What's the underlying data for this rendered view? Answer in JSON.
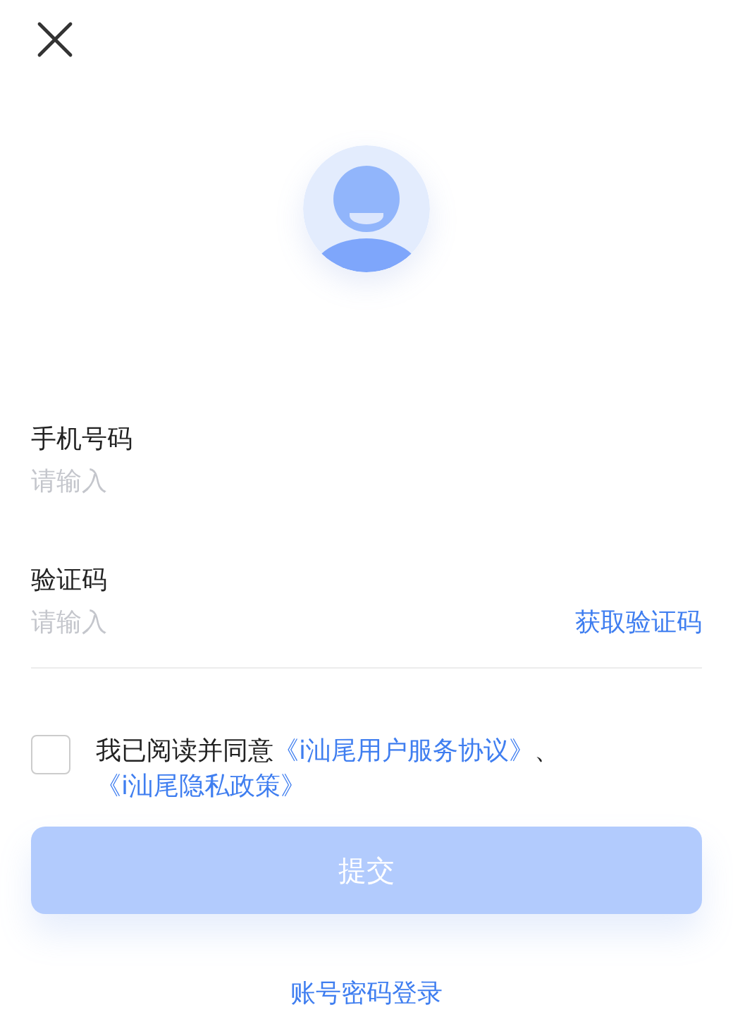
{
  "fields": [
    {
      "label": "手机号码",
      "placeholder": "请输入"
    },
    {
      "label": "验证码",
      "placeholder": "请输入",
      "action": "获取验证码"
    }
  ],
  "agreement": {
    "checked": false,
    "text": "我已阅读并同意",
    "links": [
      "《i汕尾用户服务协议》",
      "《i汕尾隐私政策》"
    ],
    "separator": "、"
  },
  "submit": {
    "label": "提交",
    "disabled": true
  },
  "alt_login": "账号密码登录"
}
